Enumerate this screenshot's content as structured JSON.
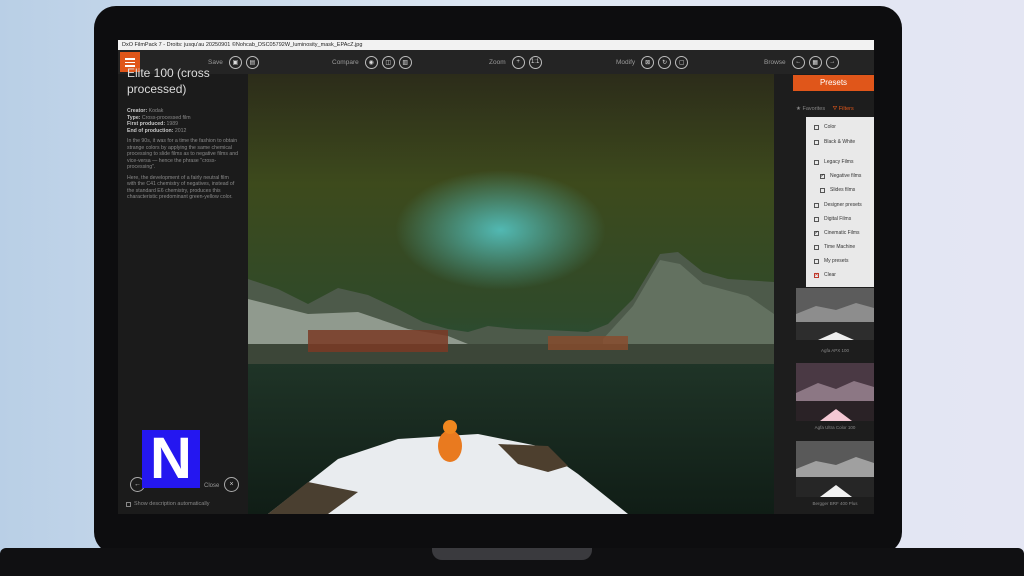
{
  "window": {
    "title": "DxO FilmPack 7 - Droits: jusqu'au 20250901 ©Nohcab_DSC05792W_luminosity_mask_EPAcZ.jpg"
  },
  "toolbar": {
    "save_label": "Save",
    "compare_label": "Compare",
    "zoom_label": "Zoom",
    "modify_label": "Modify",
    "browse_label": "Browse"
  },
  "description": {
    "title": "Elite 100 (cross processed)",
    "creator_label": "Creator:",
    "creator": "Kodak",
    "type_label": "Type:",
    "type": "Cross-processed film",
    "first_label": "First produced:",
    "first": "1989",
    "end_label": "End of production:",
    "end": "2012",
    "para1": "In the 90s, it was for a time the fashion to obtain strange colors by applying the same chemical processing to slide films as to negative films and vice-versa — hence the phrase \"cross-processing\".",
    "para2": "Here, the development of a fairly neutral film with the C41 chemistry of negatives, instead of the standard E6 chemistry, produces this characteristic predominant green-yellow color.",
    "close_label": "Close",
    "show_auto_label": "Show description automatically"
  },
  "presets": {
    "tab_label": "Presets",
    "filter_favorites": "Favorites",
    "filter_filters": "Filters",
    "menu": [
      {
        "label": "Color",
        "checked": false
      },
      {
        "label": "Black & White",
        "checked": false
      },
      {
        "label": "Legacy Films",
        "checked": false
      },
      {
        "label": "Negative films",
        "checked": true
      },
      {
        "label": "Slides films",
        "checked": false
      },
      {
        "label": "Designer presets",
        "checked": false
      },
      {
        "label": "Digital Films",
        "checked": false
      },
      {
        "label": "Cinematic Films",
        "checked": true
      },
      {
        "label": "Time Machine",
        "checked": false
      },
      {
        "label": "My presets",
        "checked": false
      },
      {
        "label": "Clear",
        "checked": false
      }
    ],
    "thumbs": [
      {
        "label": "Agfa APX 100"
      },
      {
        "label": "Agfa Ultra Color 100"
      },
      {
        "label": "Bergger BRF 400 Plus"
      }
    ]
  },
  "colors": {
    "accent": "#e0561a",
    "logo": "#2417f0"
  },
  "logo": {
    "text": "N"
  }
}
